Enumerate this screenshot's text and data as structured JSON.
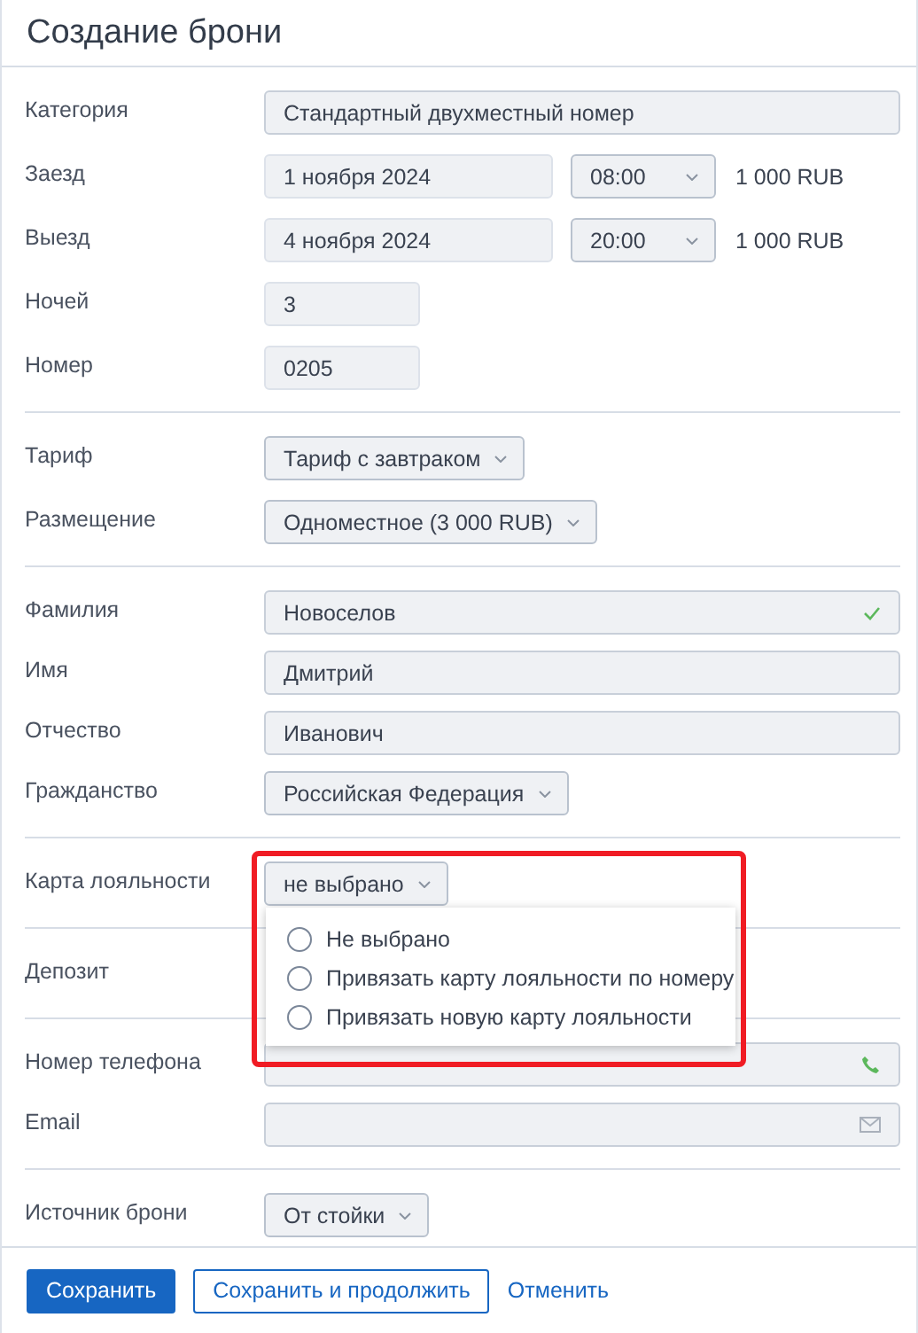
{
  "window": {
    "title": "Создание брони"
  },
  "sections": [
    {
      "rows": [
        {
          "kind": "input",
          "label": "Категория",
          "value": "Стандартный двухместный номер"
        },
        {
          "kind": "datetime",
          "label": "Заезд",
          "value": "1 ноября 2024",
          "time": "08:00",
          "price": "1 000 RUB"
        },
        {
          "kind": "datetime",
          "label": "Выезд",
          "value": "4 ноября 2024",
          "time": "20:00",
          "price": "1 000 RUB"
        },
        {
          "kind": "short_input",
          "label": "Ночей",
          "value": "3"
        },
        {
          "kind": "short_input",
          "label": "Номер",
          "value": "0205"
        }
      ]
    },
    {
      "rows": [
        {
          "kind": "select",
          "label": "Тариф",
          "value": "Тариф с завтраком"
        },
        {
          "kind": "select",
          "label": "Размещение",
          "value": "Одноместное (3 000 RUB)"
        }
      ]
    },
    {
      "rows": [
        {
          "kind": "input",
          "label": "Фамилия",
          "value": "Новоселов",
          "valid": true
        },
        {
          "kind": "input",
          "label": "Имя",
          "value": "Дмитрий"
        },
        {
          "kind": "input",
          "label": "Отчество",
          "value": "Иванович"
        },
        {
          "kind": "select",
          "label": "Гражданство",
          "value": "Российская Федерация"
        }
      ]
    },
    {
      "rows": [
        {
          "kind": "select",
          "label": "Карта лояльности",
          "value": "не выбрано",
          "expanded": true,
          "highlighted": true,
          "options": [
            {
              "label": "Не выбрано",
              "selected": false
            },
            {
              "label": "Привязать карту лояльности по номеру",
              "selected": false
            },
            {
              "label": "Привязать новую карту лояльности",
              "selected": false
            }
          ]
        }
      ]
    },
    {
      "rows": [
        {
          "kind": "label",
          "label": "Депозит"
        }
      ]
    },
    {
      "rows": [
        {
          "kind": "phone_input",
          "label": "Номер телефона",
          "valid": true
        },
        {
          "kind": "email_input",
          "label": "Email"
        }
      ]
    },
    {
      "rows": [
        {
          "kind": "select",
          "label": "Источник брони",
          "value": "От стойки"
        }
      ]
    }
  ],
  "footer": {
    "buttons": [
      {
        "kind": "primary",
        "label": "Сохранить"
      },
      {
        "kind": "outline",
        "label": "Сохранить и продолжить"
      },
      {
        "kind": "link",
        "label": "Отменить"
      }
    ]
  }
}
